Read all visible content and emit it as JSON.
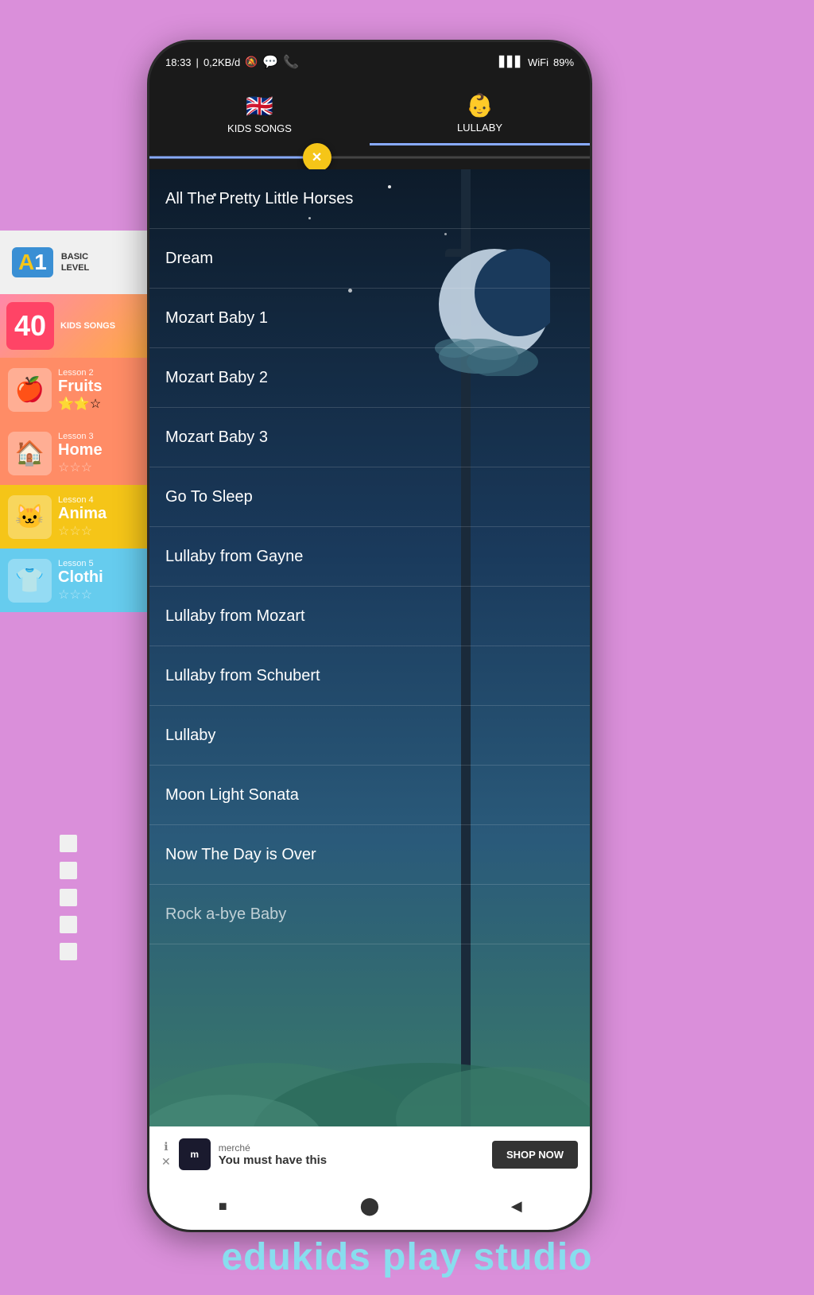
{
  "app": {
    "title": "edukids play studio"
  },
  "status_bar": {
    "time": "18:33",
    "data": "0,2KB/d",
    "battery": "89"
  },
  "tabs": [
    {
      "id": "kids-songs",
      "label": "KIDS SONGS",
      "icon": "🇬🇧",
      "active": false
    },
    {
      "id": "lullaby",
      "label": "LULLABY",
      "icon": "👶",
      "active": true
    }
  ],
  "slider": {
    "close_label": "✕"
  },
  "songs": [
    {
      "id": 1,
      "title": "All The Pretty Little Horses"
    },
    {
      "id": 2,
      "title": "Dream"
    },
    {
      "id": 3,
      "title": "Mozart Baby 1"
    },
    {
      "id": 4,
      "title": "Mozart Baby 2"
    },
    {
      "id": 5,
      "title": "Mozart Baby 3"
    },
    {
      "id": 6,
      "title": "Go To Sleep"
    },
    {
      "id": 7,
      "title": "Lullaby from Gayne"
    },
    {
      "id": 8,
      "title": "Lullaby from Mozart"
    },
    {
      "id": 9,
      "title": "Lullaby from Schubert"
    },
    {
      "id": 10,
      "title": "Lullaby"
    },
    {
      "id": 11,
      "title": "Moon Light Sonata"
    },
    {
      "id": 12,
      "title": "Now The Day is Over"
    },
    {
      "id": 13,
      "title": "Rock a-bye Baby"
    }
  ],
  "sidebar": {
    "a1_label": "A",
    "a1_num": "1",
    "basic_level_line1": "BASIC",
    "basic_level_line2": "LEVEL",
    "lessons": [
      {
        "num": "Lesson 2",
        "name": "Fruits",
        "icon": "🍎",
        "stars": 2,
        "max_stars": 3
      },
      {
        "num": "Lesson 3",
        "name": "Home",
        "icon": "🏠",
        "stars": 0,
        "max_stars": 3
      },
      {
        "num": "Lesson 4",
        "name": "Anima",
        "icon": "🐱",
        "stars": 0,
        "max_stars": 3
      },
      {
        "num": "Lesson 5",
        "name": "Clothi",
        "icon": "👕",
        "stars": 0,
        "max_stars": 3
      }
    ]
  },
  "ad": {
    "brand": "merché",
    "tagline": "You must have this",
    "cta": "SHOP NOW"
  },
  "nav": {
    "stop_icon": "■",
    "home_icon": "⬤",
    "back_icon": "◀"
  }
}
